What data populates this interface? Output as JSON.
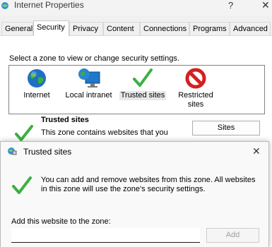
{
  "window": {
    "title": "Internet Properties",
    "help_glyph": "?",
    "close_glyph": "✕"
  },
  "tabs": [
    {
      "label": "General"
    },
    {
      "label": "Security"
    },
    {
      "label": "Privacy"
    },
    {
      "label": "Content"
    },
    {
      "label": "Connections"
    },
    {
      "label": "Programs"
    },
    {
      "label": "Advanced"
    }
  ],
  "security": {
    "prompt": "Select a zone to view or change security settings.",
    "zones": [
      {
        "label": "Internet",
        "icon": "globe-icon"
      },
      {
        "label": "Local intranet",
        "icon": "intranet-icon"
      },
      {
        "label": "Trusted sites",
        "icon": "checkmark-icon"
      },
      {
        "label": "Restricted\nsites",
        "icon": "restricted-icon"
      }
    ],
    "selected_zone": "Trusted sites",
    "section_title": "Trusted sites",
    "section_desc": "This zone contains websites that you",
    "sites_button": "Sites"
  },
  "trusted_dialog": {
    "title": "Trusted sites",
    "close_glyph": "✕",
    "description": "You can add and remove websites from this zone. All websites in this zone will use the zone's security settings.",
    "add_label": "Add this website to the zone:",
    "add_value": "",
    "add_button": "Add"
  },
  "colors": {
    "accent_check": "#3cb043",
    "restricted_red": "#d42020",
    "disabled_text": "#a0a0a0"
  }
}
